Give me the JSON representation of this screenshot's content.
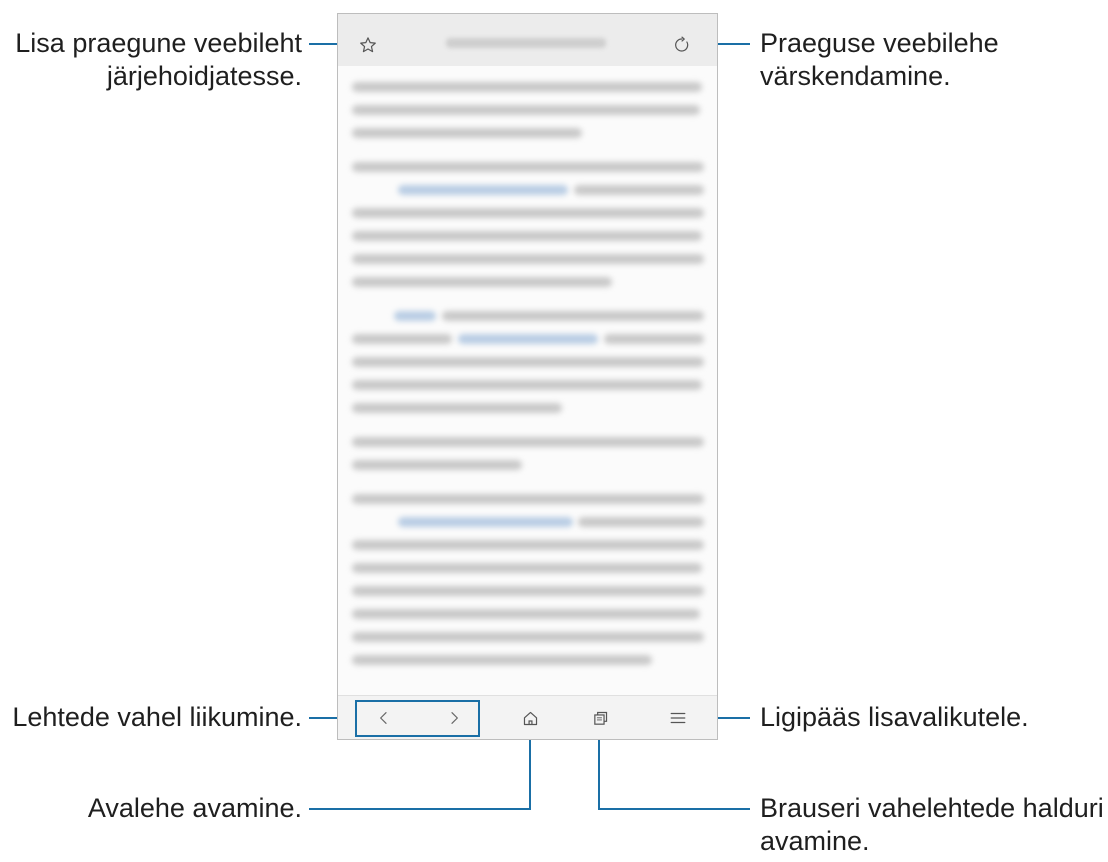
{
  "annotations": {
    "bookmark": [
      "Lisa praegune veebileht",
      "järjehoidjatesse."
    ],
    "refresh": [
      "Praeguse veebilehe",
      "värskendamine."
    ],
    "navigate": [
      "Lehtede vahel liikumine."
    ],
    "more": [
      "Ligipääs lisavalikutele."
    ],
    "home": [
      "Avalehe avamine."
    ],
    "tabs": [
      "Brauseri vahelehtede halduri",
      "avamine."
    ]
  },
  "icons": {
    "bookmark": "star-outline-icon",
    "refresh": "refresh-icon",
    "back": "chevron-left-icon",
    "forward": "chevron-right-icon",
    "home": "home-icon",
    "tabs": "tabs-icon",
    "menu": "hamburger-menu-icon"
  },
  "colors": {
    "callout_line": "#1a6fa6",
    "url_bar": "#ececec"
  }
}
